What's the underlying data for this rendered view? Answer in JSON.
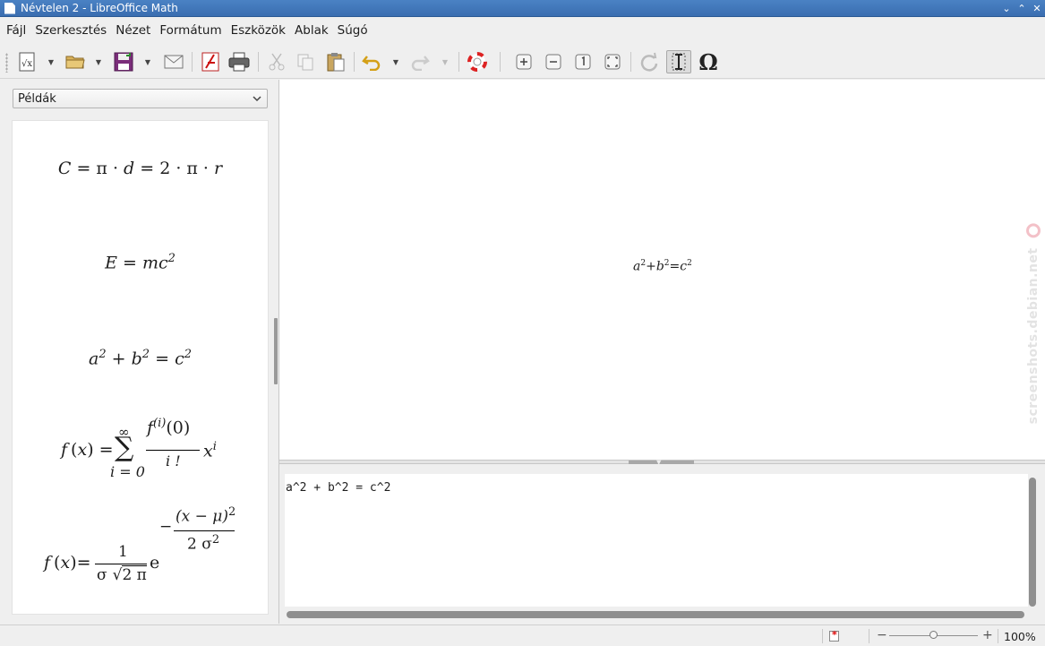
{
  "window": {
    "title": "Névtelen 2 - LibreOffice Math"
  },
  "menu": [
    "Fájl",
    "Szerkesztés",
    "Nézet",
    "Formátum",
    "Eszközök",
    "Ablak",
    "Súgó"
  ],
  "sidebar": {
    "selected": "Példák"
  },
  "examples": {
    "circle": {
      "lhs": "C",
      "rest1": " = π · ",
      "d": "d",
      "rest2": " = 2 · π · ",
      "r": "r"
    },
    "energy": {
      "lhs": "E",
      "eq": " = ",
      "m": "m",
      "c": "c",
      "exp": "2"
    },
    "pythagoras": {
      "a": "a",
      "exp": "2",
      "plus": " + ",
      "b": "b",
      "eq": " = ",
      "c": "c"
    },
    "taylor": {
      "f": "f",
      "x": "x",
      "sum_top": "∞",
      "sum_bottom": "i = 0",
      "num": "f",
      "num_exp": "(i)",
      "num_arg": "(0)",
      "den": "i !",
      "exp": "i"
    },
    "gauss": {
      "f": "f",
      "x": "x",
      "one": "1",
      "sigma": "σ",
      "sqrt": "2 π",
      "e": "e",
      "minus": "−",
      "num": "(x − μ)",
      "num_exp": "2",
      "den": "2 σ",
      "den_exp": "2"
    }
  },
  "preview": {
    "a": "a",
    "b": "b",
    "c": "c",
    "exp": "2",
    "plus": "+",
    "eq": "="
  },
  "editor": {
    "text": "a^2 + b^2 = c^2"
  },
  "watermark": "screenshots.debian.net",
  "status": {
    "zoom": "100%"
  }
}
